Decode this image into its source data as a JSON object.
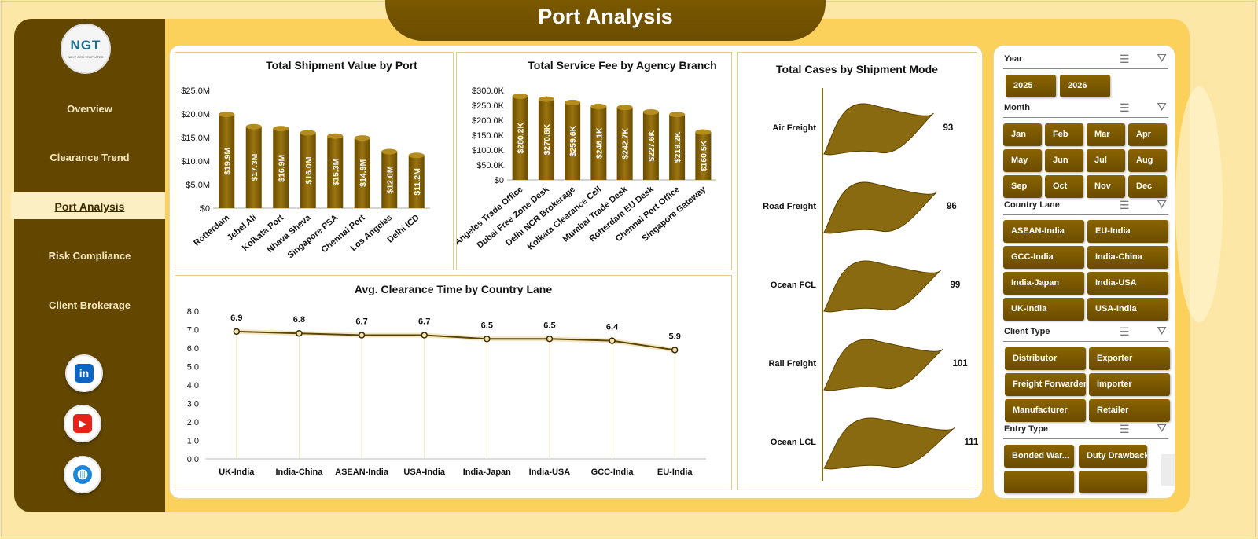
{
  "header": {
    "title": "Port Analysis"
  },
  "sidebar": {
    "logo_text": "NGT",
    "logo_sub": "NEXT GEN TEMPLATES",
    "items": [
      {
        "label": "Overview"
      },
      {
        "label": "Clearance Trend"
      },
      {
        "label": "Port Analysis",
        "active": true
      },
      {
        "label": "Risk Compliance"
      },
      {
        "label": "Client Brokerage"
      }
    ],
    "social": [
      {
        "name": "linkedin-icon",
        "glyph": "in",
        "color": "#0a66c2"
      },
      {
        "name": "youtube-icon",
        "glyph": "▶",
        "color": "#e62117"
      },
      {
        "name": "website-icon",
        "glyph": "◍",
        "color": "#1c86d8"
      }
    ]
  },
  "chart_data": [
    {
      "type": "bar",
      "title": "Total Shipment Value by Port",
      "categories": [
        "Rotterdam",
        "Jebel Ali",
        "Kolkata Port",
        "Nhava Sheva",
        "Singapore PSA",
        "Chennai Port",
        "Los Angeles",
        "Delhi ICD"
      ],
      "values": [
        19.9,
        17.3,
        16.9,
        16.0,
        15.3,
        14.9,
        12.0,
        11.2
      ],
      "data_labels": [
        "$19.9M",
        "$17.3M",
        "$16.9M",
        "$16.0M",
        "$15.3M",
        "$14.9M",
        "$12.0M",
        "$11.2M"
      ],
      "yticks": [
        "$0",
        "$5.0M",
        "$10.0M",
        "$15.0M",
        "$20.0M",
        "$25.0M"
      ],
      "ylim": [
        0,
        25
      ],
      "unit": "M",
      "color": "#7a5a05"
    },
    {
      "type": "bar",
      "title": "Total Service Fee by Agency Branch",
      "categories": [
        "Los Angeles Trade Office",
        "Dubai Free Zone Desk",
        "Delhi NCR Brokerage",
        "Kolkata Clearance Cell",
        "Mumbai Trade Desk",
        "Rotterdam EU Desk",
        "Chennai Port Office",
        "Singapore Gateway"
      ],
      "values": [
        280.2,
        270.6,
        259.6,
        246.1,
        242.7,
        227.6,
        219.2,
        160.5
      ],
      "data_labels": [
        "$280.2K",
        "$270.6K",
        "$259.6K",
        "$246.1K",
        "$242.7K",
        "$227.6K",
        "$219.2K",
        "$160.5K"
      ],
      "yticks": [
        "$0",
        "$50.0K",
        "$100.0K",
        "$150.0K",
        "$200.0K",
        "$250.0K",
        "$300.0K"
      ],
      "ylim": [
        0,
        300
      ],
      "unit": "K",
      "color": "#7a5a05"
    },
    {
      "type": "bar",
      "orientation": "horizontal",
      "title": "Total Cases by Shipment Mode",
      "categories": [
        "Air Freight",
        "Road Freight",
        "Ocean FCL",
        "Rail Freight",
        "Ocean LCL"
      ],
      "values": [
        93,
        96,
        99,
        101,
        111
      ],
      "color": "#8a6a10"
    },
    {
      "type": "line",
      "title": "Avg. Clearance Time by Country Lane",
      "categories": [
        "UK-India",
        "India-China",
        "ASEAN-India",
        "USA-India",
        "India-Japan",
        "India-USA",
        "GCC-India",
        "EU-India"
      ],
      "values": [
        6.9,
        6.8,
        6.7,
        6.7,
        6.5,
        6.5,
        6.4,
        5.9
      ],
      "yticks": [
        "0.0",
        "1.0",
        "2.0",
        "3.0",
        "4.0",
        "5.0",
        "6.0",
        "7.0",
        "8.0"
      ],
      "ylim": [
        0,
        8
      ],
      "color": "#5c4500"
    }
  ],
  "slicers": {
    "year": {
      "label": "Year",
      "options": [
        "2025",
        "2026"
      ]
    },
    "month": {
      "label": "Month",
      "options": [
        "Jan",
        "Feb",
        "Mar",
        "Apr",
        "May",
        "Jun",
        "Jul",
        "Aug",
        "Sep",
        "Oct",
        "Nov",
        "Dec"
      ]
    },
    "country_lane": {
      "label": "Country Lane",
      "options": [
        "ASEAN-India",
        "EU-India",
        "GCC-India",
        "India-China",
        "India-Japan",
        "India-USA",
        "UK-India",
        "USA-India"
      ]
    },
    "client_type": {
      "label": "Client Type",
      "options": [
        "Distributor",
        "Exporter",
        "Freight Forwarder",
        "Importer",
        "Manufacturer",
        "Retailer"
      ]
    },
    "entry_type": {
      "label": "Entry Type",
      "options": [
        "Bonded War...",
        "Duty Drawback"
      ]
    }
  }
}
